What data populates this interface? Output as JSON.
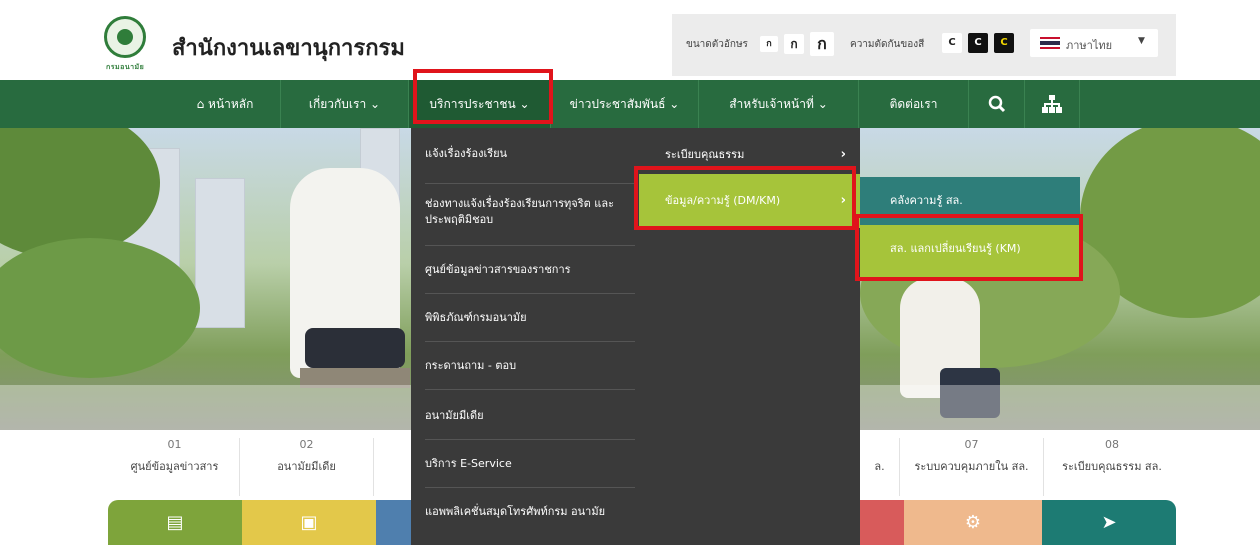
{
  "header": {
    "logo_text": "กรมอนามัย",
    "title": "สำนักงานเลขานุการกรม"
  },
  "toolbar": {
    "font_size_label": "ขนาดตัวอักษร",
    "font_sizes": [
      "ก",
      "ก",
      "ก"
    ],
    "contrast_label": "ความตัดกันของสี",
    "contrast_buttons": [
      "C",
      "C",
      "C"
    ],
    "language": "ภาษาไทย"
  },
  "nav": {
    "home": "หน้าหลัก",
    "about": "เกี่ยวกับเรา",
    "services": "บริการประชาชน",
    "pr": "ข่าวประชาสัมพันธ์",
    "staff": "สำหรับเจ้าหน้าที่",
    "contact": "ติดต่อเรา"
  },
  "dropdown_level1": [
    "แจ้งเรื่องร้องเรียน",
    "ช่องทางแจ้งเรื่องร้องเรียนการทุจริต และประพฤติมิชอบ",
    "ศูนย์ข้อมูลข่าวสารของราชการ",
    "พิพิธภัณฑ์กรมอนามัย",
    "กระดานถาม - ตอบ",
    "อนามัยมีเดีย",
    "บริการ E-Service",
    "แอพพลิเคชั่นสมุดโทรศัพท์กรม อนามัย"
  ],
  "dropdown_level2": [
    "ระเบียบคุณธรรม",
    "ข้อมูล/ความรู้ (DM/KM)"
  ],
  "dropdown_level3": [
    "คลังความรู้ สล.",
    "สล. แลกเปลี่ยนเรียนรู้ (KM)"
  ],
  "services": [
    {
      "num": "01",
      "label": "ศูนย์ข้อมูลข่าวสาร"
    },
    {
      "num": "02",
      "label": "อนามัยมีเดีย"
    },
    {
      "num": "07",
      "label": "ระบบควบคุมภายใน สล."
    },
    {
      "num": "08",
      "label": "ระเบียบคุณธรรม สล."
    }
  ],
  "partial_label": "ล.",
  "colors": {
    "nav_green": "#286b3f",
    "menu_dark": "#3a3a3a",
    "highlight_lime": "#a6c43a",
    "highlight_teal": "#2e7e7a",
    "annotation_red": "#e0141b"
  },
  "icons": {
    "home": "home-icon",
    "search": "search-icon",
    "sitemap": "sitemap-icon"
  }
}
